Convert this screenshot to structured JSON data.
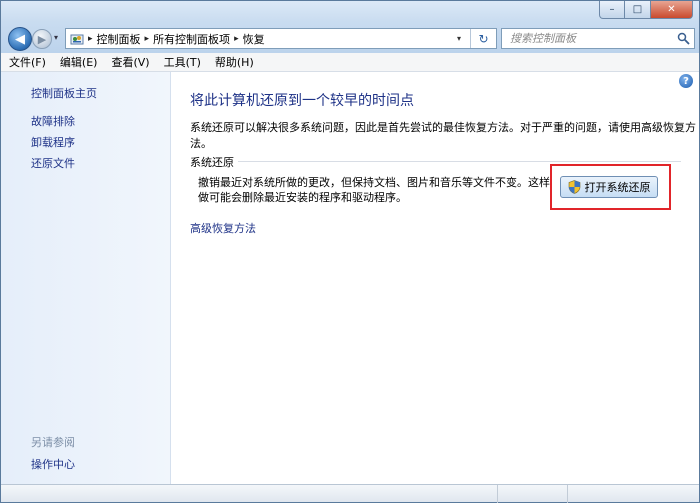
{
  "window": {
    "caption_buttons": {
      "minimize": "–",
      "maximize": "□",
      "close": "✕"
    }
  },
  "nav": {
    "back_icon": "back-arrow-icon",
    "forward_icon": "forward-arrow-icon",
    "history_arrow": "▾"
  },
  "address": {
    "crumbs": [
      "控制面板",
      "所有控制面板项",
      "恢复"
    ],
    "separator": "▸",
    "dropdown": "▾",
    "refresh_glyph": "↻"
  },
  "search": {
    "placeholder": "搜索控制面板"
  },
  "menu": {
    "items": [
      "文件(F)",
      "编辑(E)",
      "查看(V)",
      "工具(T)",
      "帮助(H)"
    ]
  },
  "sidebar": {
    "home": "控制面板主页",
    "links": [
      "故障排除",
      "卸载程序",
      "还原文件"
    ],
    "see_also_heading": "另请参阅",
    "see_also_links": [
      "操作中心"
    ]
  },
  "main": {
    "help": "?",
    "title": "将此计算机还原到一个较早的时间点",
    "description": "系统还原可以解决很多系统问题，因此是首先尝试的最佳恢复方法。对于严重的问题，请使用高级恢复方法。",
    "section_label": "系统还原",
    "restore_text": "撤销最近对系统所做的更改，但保持文档、图片和音乐等文件不变。这样做可能会删除最近安装的程序和驱动程序。",
    "open_button": "打开系统还原",
    "advanced_link": "高级恢复方法"
  },
  "colors": {
    "link": "#1e3287",
    "highlight_border": "#e1252a",
    "sidebar_bg": "#e5eefa"
  }
}
